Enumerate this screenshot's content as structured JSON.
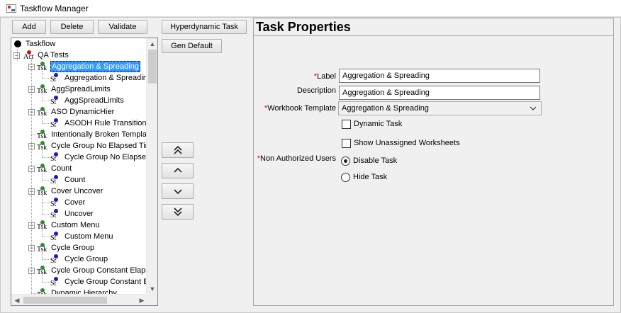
{
  "window": {
    "title": "Taskflow Manager"
  },
  "toolbar": {
    "add": "Add",
    "delete": "Delete",
    "validate": "Validate",
    "hyperdynamic": "Hyperdynamic Task",
    "gen_default": "Gen Default"
  },
  "tree": {
    "root": "Taskflow",
    "activity": {
      "prefix": "Act",
      "label": "QA Tests"
    },
    "items": [
      {
        "type": "Tsk",
        "label": "Aggregation & Spreading",
        "selected": true,
        "child": "Aggregation & Spreadin"
      },
      {
        "type": "Tsk",
        "label": "AggSpreadLimits",
        "child": "AggSpreadLimits"
      },
      {
        "type": "Tsk",
        "label": "ASO DynamicHier",
        "child": "ASODH Rule Transitions"
      },
      {
        "type": "Tsk",
        "label": "Intentionally Broken Templa"
      },
      {
        "type": "Tsk",
        "label": "Cycle Group No Elapsed Tim",
        "child": "Cycle Group No Elapsed"
      },
      {
        "type": "Tsk",
        "label": "Count",
        "child": "Count"
      },
      {
        "type": "Tsk",
        "label": "Cover Uncover",
        "children": [
          "Cover",
          "Uncover"
        ]
      },
      {
        "type": "Tsk",
        "label": "Custom Menu",
        "child": "Custom Menu"
      },
      {
        "type": "Tsk",
        "label": "Cycle Group",
        "child": "Cycle Group"
      },
      {
        "type": "Tsk",
        "label": "Cycle Group Constant Elaps",
        "child": "Cycle Group Constant E"
      },
      {
        "type": "Tsk",
        "label": "Dynamic Hierarchy"
      }
    ],
    "step_prefix": "St"
  },
  "properties": {
    "title": "Task Properties",
    "label_field": {
      "label": "Label",
      "value": "Aggregation & Spreading"
    },
    "description_field": {
      "label": "Description",
      "value": "Aggregation & Spreading"
    },
    "template_field": {
      "label": "Workbook Template",
      "value": "Aggregation & Spreading"
    },
    "dynamic_task": "Dynamic Task",
    "show_unassigned": "Show Unassigned Worksheets",
    "non_authorized": {
      "label": "Non Authorized Users",
      "options": [
        "Disable Task",
        "Hide Task"
      ],
      "selected": "Disable Task"
    },
    "required_mark": "*"
  },
  "colors": {
    "task_icon": "#2e8b2e",
    "step_icon": "#1a1acc",
    "activity_icon": "#c01818",
    "selection": "#3399ff"
  }
}
